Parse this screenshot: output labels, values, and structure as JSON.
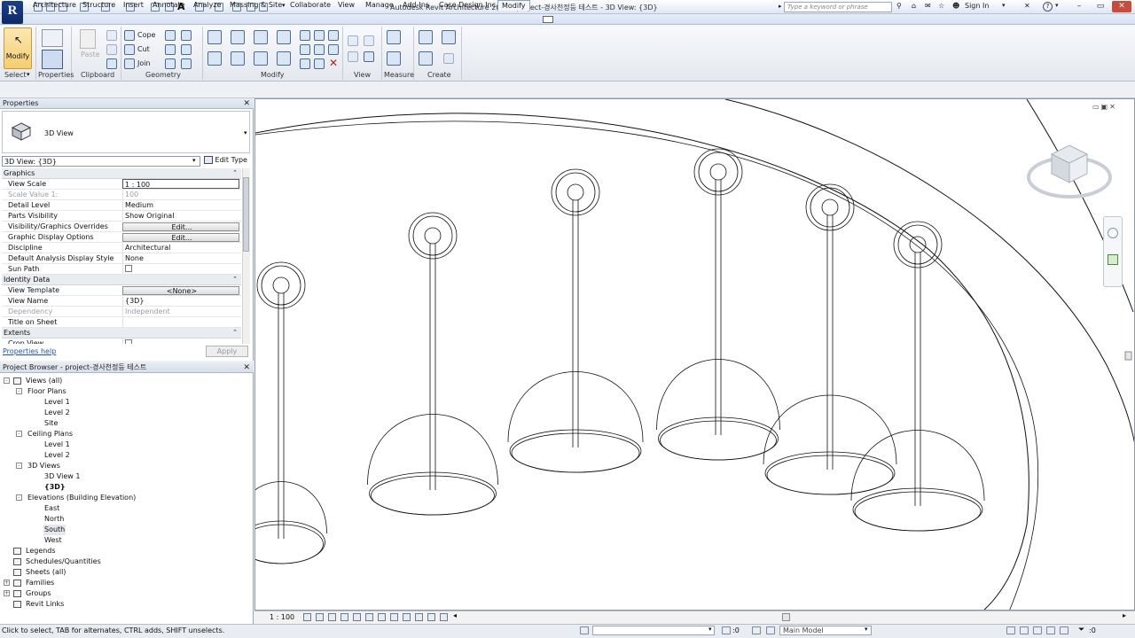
{
  "app": {
    "logo_letter": "R",
    "window_title": "Autodesk Revit Architecture 2014 -    project-경사천정등 테스트 - 3D View: {3D}",
    "search_placeholder": "Type a keyword or phrase",
    "sign_in": "Sign In",
    "help": "?"
  },
  "tabs": [
    "Architecture",
    "Structure",
    "Insert",
    "Annotate",
    "Analyze",
    "Massing & Site",
    "Collaborate",
    "View",
    "Manage",
    "Add-Ins",
    "Case Design Inc.",
    "Modify"
  ],
  "active_tab": "Modify",
  "ribbon": {
    "modify_label": "Modify",
    "panels": [
      "Select",
      "Properties",
      "Clipboard",
      "Geometry",
      "Modify",
      "View",
      "Measure",
      "Create"
    ],
    "paste_label": "Paste",
    "cope_label": "Cope",
    "cut_label": "Cut",
    "join_label": "Join"
  },
  "properties": {
    "header": "Properties",
    "type_name": "3D View",
    "view_selector": "3D View: {3D}",
    "edit_type": "Edit Type",
    "groups": [
      {
        "name": "Graphics",
        "rows": [
          {
            "name": "View Scale",
            "value": "1 : 100",
            "kind": "input"
          },
          {
            "name": "Scale Value    1:",
            "value": "100",
            "kind": "grey"
          },
          {
            "name": "Detail Level",
            "value": "Medium",
            "kind": "text"
          },
          {
            "name": "Parts Visibility",
            "value": "Show Original",
            "kind": "text"
          },
          {
            "name": "Visibility/Graphics Overrides",
            "value": "Edit...",
            "kind": "button"
          },
          {
            "name": "Graphic Display Options",
            "value": "Edit...",
            "kind": "button"
          },
          {
            "name": "Discipline",
            "value": "Architectural",
            "kind": "text"
          },
          {
            "name": "Default Analysis Display Style",
            "value": "None",
            "kind": "text"
          },
          {
            "name": "Sun Path",
            "value": "",
            "kind": "checkbox"
          }
        ]
      },
      {
        "name": "Identity Data",
        "rows": [
          {
            "name": "View Template",
            "value": "<None>",
            "kind": "button"
          },
          {
            "name": "View Name",
            "value": "{3D}",
            "kind": "text"
          },
          {
            "name": "Dependency",
            "value": "Independent",
            "kind": "grey"
          },
          {
            "name": "Title on Sheet",
            "value": "",
            "kind": "text"
          }
        ]
      },
      {
        "name": "Extents",
        "rows": [
          {
            "name": "Crop View",
            "value": "",
            "kind": "checkbox"
          }
        ]
      }
    ],
    "help_link": "Properties help",
    "apply": "Apply"
  },
  "browser": {
    "header": "Project Browser - project-경사천정등 테스트",
    "items": [
      {
        "label": "Views (all)",
        "level": 0,
        "toggle": "-",
        "icon": true
      },
      {
        "label": "Floor Plans",
        "level": 1,
        "toggle": "-"
      },
      {
        "label": "Level 1",
        "level": 2
      },
      {
        "label": "Level 2",
        "level": 2
      },
      {
        "label": "Site",
        "level": 2
      },
      {
        "label": "Ceiling Plans",
        "level": 1,
        "toggle": "-"
      },
      {
        "label": "Level 1",
        "level": 2
      },
      {
        "label": "Level 2",
        "level": 2
      },
      {
        "label": "3D Views",
        "level": 1,
        "toggle": "-"
      },
      {
        "label": "3D View 1",
        "level": 2
      },
      {
        "label": "{3D}",
        "level": 2,
        "bold": true
      },
      {
        "label": "Elevations (Building Elevation)",
        "level": 1,
        "toggle": "-"
      },
      {
        "label": "East",
        "level": 2
      },
      {
        "label": "North",
        "level": 2
      },
      {
        "label": "South",
        "level": 2,
        "selected": true
      },
      {
        "label": "West",
        "level": 2
      },
      {
        "label": "Legends",
        "level": 0,
        "icon": true
      },
      {
        "label": "Schedules/Quantities",
        "level": 0,
        "icon": true
      },
      {
        "label": "Sheets (all)",
        "level": 0,
        "icon": true
      },
      {
        "label": "Families",
        "level": 0,
        "toggle": "+",
        "icon": true
      },
      {
        "label": "Groups",
        "level": 0,
        "toggle": "+",
        "icon": true
      },
      {
        "label": "Revit Links",
        "level": 0,
        "icon": true
      }
    ]
  },
  "view_bar": {
    "scale": "1 : 100"
  },
  "status": {
    "message": "Click to select, TAB for alternates, CTRL adds, SHIFT unselects.",
    "zero": ":0",
    "model": "Main Model",
    "filter": ":0"
  },
  "colors": {
    "accent_blue": "#1b3f8c",
    "ribbon_bg": "#e4e8ee",
    "selected_tool": "#f5cf6f"
  }
}
